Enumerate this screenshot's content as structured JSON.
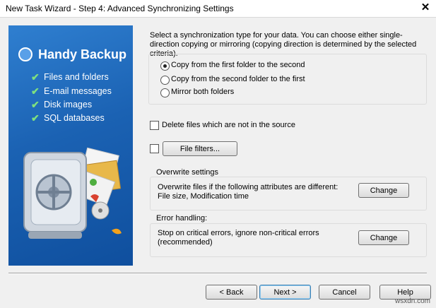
{
  "window": {
    "title": "New Task Wizard - Step 4: Advanced Synchronizing Settings",
    "close_glyph": "✕"
  },
  "side_panel": {
    "brand": "Handy Backup",
    "features": [
      "Files and folders",
      "E-mail messages",
      "Disk images",
      "SQL databases"
    ],
    "check_glyph": "✔",
    "logo_icon": "handy-backup-logo-icon",
    "illustration": "safe-with-documents-illustration"
  },
  "main": {
    "description": "Select a synchronization type for your data. You can choose either single-direction copying or mirroring (copying direction is determined by the selected criteria).",
    "sync_options": [
      {
        "label": "Copy from the first folder to the second",
        "selected": true
      },
      {
        "label": "Copy from the second folder to the first",
        "selected": false
      },
      {
        "label": "Mirror both folders",
        "selected": false
      }
    ],
    "delete_files": {
      "label": "Delete files which are not in the source",
      "checked": false
    },
    "file_filters": {
      "checked": false,
      "button_label": "File filters..."
    },
    "overwrite": {
      "title": "Overwrite settings",
      "text": "Overwrite files if the following attributes are different: File size, Modification time",
      "button_label": "Change"
    },
    "error_handling": {
      "title": "Error handling:",
      "text": "Stop on critical errors, ignore non-critical errors (recommended)",
      "button_label": "Change"
    }
  },
  "footer": {
    "back_label": "< Back",
    "next_label": "Next >",
    "cancel_label": "Cancel",
    "help_label": "Help"
  },
  "watermark": "wsxdn.com",
  "colors": {
    "panel_blue": "#1b62b3",
    "check_green": "#7fe07f",
    "default_button_border": "#3c7fb1"
  }
}
